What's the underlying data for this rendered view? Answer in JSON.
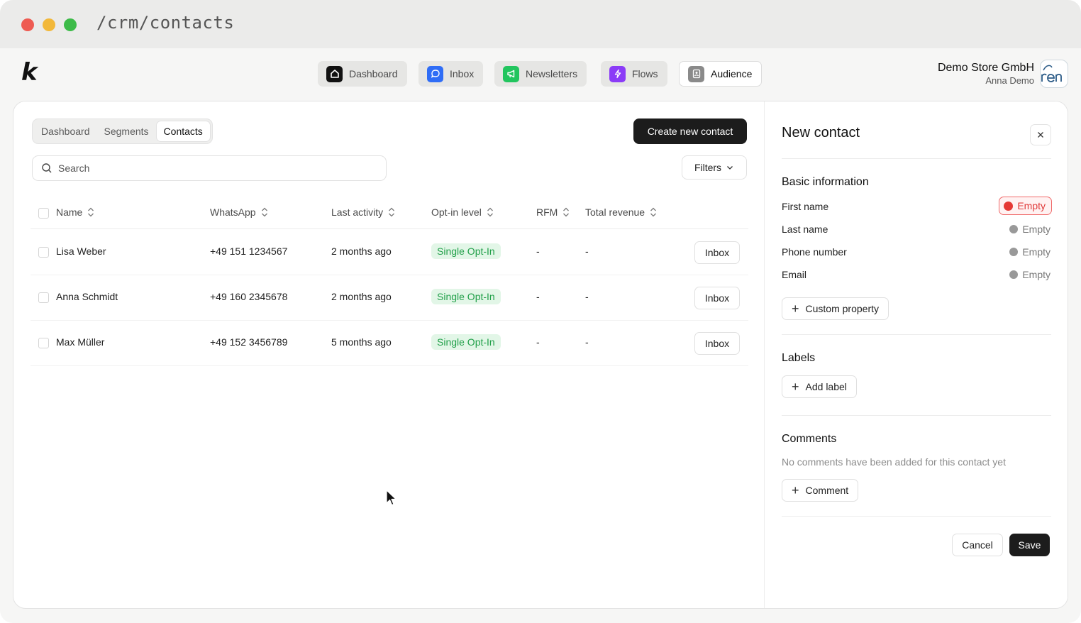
{
  "window": {
    "url": "/crm/contacts"
  },
  "app": {
    "logo": "k",
    "nav": [
      {
        "label": "Dashboard",
        "icon": "home-icon",
        "color": "#111111"
      },
      {
        "label": "Inbox",
        "icon": "chat-icon",
        "color": "#2f6df6"
      },
      {
        "label": "Newsletters",
        "icon": "megaphone-icon",
        "color": "#22c55e"
      },
      {
        "label": "Flows",
        "icon": "lightning-icon",
        "color": "#8b3cf7"
      },
      {
        "label": "Audience",
        "icon": "contact-card-icon",
        "color": "#8a8a8a"
      }
    ],
    "store_name": "Demo Store GmbH",
    "user_name": "Anna Demo"
  },
  "subtabs": [
    "Dashboard",
    "Segments",
    "Contacts"
  ],
  "create_button": "Create new contact",
  "search": {
    "placeholder": "Search"
  },
  "filters_label": "Filters",
  "table": {
    "columns": [
      "Name",
      "WhatsApp",
      "Last activity",
      "Opt-in level",
      "RFM",
      "Total revenue"
    ],
    "rows": [
      {
        "name": "Lisa Weber",
        "whatsapp": "+49 151 1234567",
        "last_activity": "2 months ago",
        "opt_in": "Single Opt-In",
        "rfm": "-",
        "revenue": "-",
        "action": "Inbox"
      },
      {
        "name": "Anna Schmidt",
        "whatsapp": "+49 160 2345678",
        "last_activity": "2 months ago",
        "opt_in": "Single Opt-In",
        "rfm": "-",
        "revenue": "-",
        "action": "Inbox"
      },
      {
        "name": "Max Müller",
        "whatsapp": "+49 152 3456789",
        "last_activity": "5 months ago",
        "opt_in": "Single Opt-In",
        "rfm": "-",
        "revenue": "-",
        "action": "Inbox"
      }
    ]
  },
  "panel": {
    "title": "New contact",
    "basic_title": "Basic information",
    "fields": [
      {
        "label": "First name",
        "value": "Empty",
        "status": "error"
      },
      {
        "label": "Last name",
        "value": "Empty",
        "status": "empty"
      },
      {
        "label": "Phone number",
        "value": "Empty",
        "status": "empty"
      },
      {
        "label": "Email",
        "value": "Empty",
        "status": "empty"
      }
    ],
    "custom_property": "Custom property",
    "labels_title": "Labels",
    "add_label": "Add label",
    "comments_title": "Comments",
    "no_comments": "No comments have been added for this contact yet",
    "comment_button": "Comment",
    "cancel": "Cancel",
    "save": "Save"
  }
}
